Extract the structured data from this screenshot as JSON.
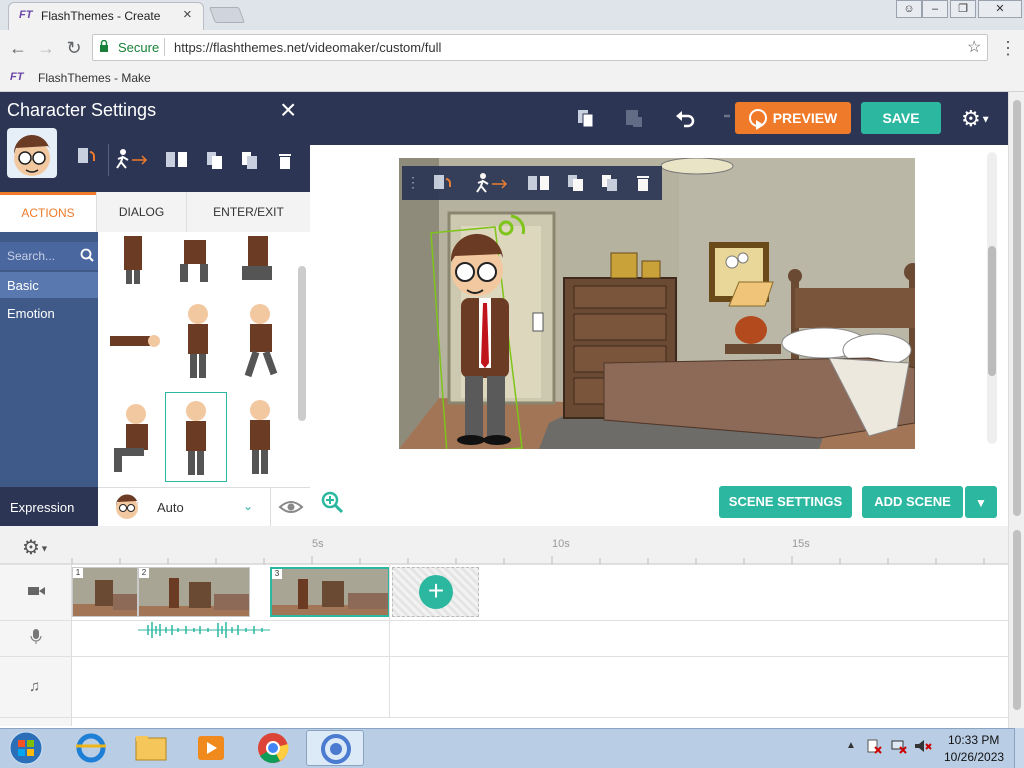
{
  "browser": {
    "tab_title": "FlashThemes - Create",
    "tab_close": "×",
    "secure_label": "Secure",
    "url": "https://flashthemes.net/videomaker/custom/full",
    "bookmark": "FlashThemes - Make",
    "favicon_text": "FT"
  },
  "header": {
    "preview_label": "PREVIEW",
    "save_label": "SAVE"
  },
  "char_panel": {
    "title": "Character Settings",
    "close": "×",
    "tabs": [
      "ACTIONS",
      "DIALOG",
      "ENTER/EXIT"
    ],
    "active_tab": "ACTIONS",
    "search_placeholder": "Search...",
    "categories": [
      "Basic",
      "Emotion"
    ],
    "expression_label": "Expression",
    "expression_value": "Auto"
  },
  "stage": {
    "scene_settings_label": "SCENE SETTINGS",
    "add_scene_label": "ADD SCENE"
  },
  "timeline": {
    "ticks": [
      "5s",
      "10s",
      "15s"
    ],
    "scenes": [
      "1",
      "2",
      "3"
    ],
    "selected_scene": "3"
  },
  "taskbar": {
    "time": "10:33 PM",
    "date": "10/26/2023"
  },
  "colors": {
    "header_bg": "#2c3654",
    "accent_teal": "#2bb7a0",
    "preview_orange": "#ef7a2a",
    "sidebar_blue": "#3f5a88"
  }
}
